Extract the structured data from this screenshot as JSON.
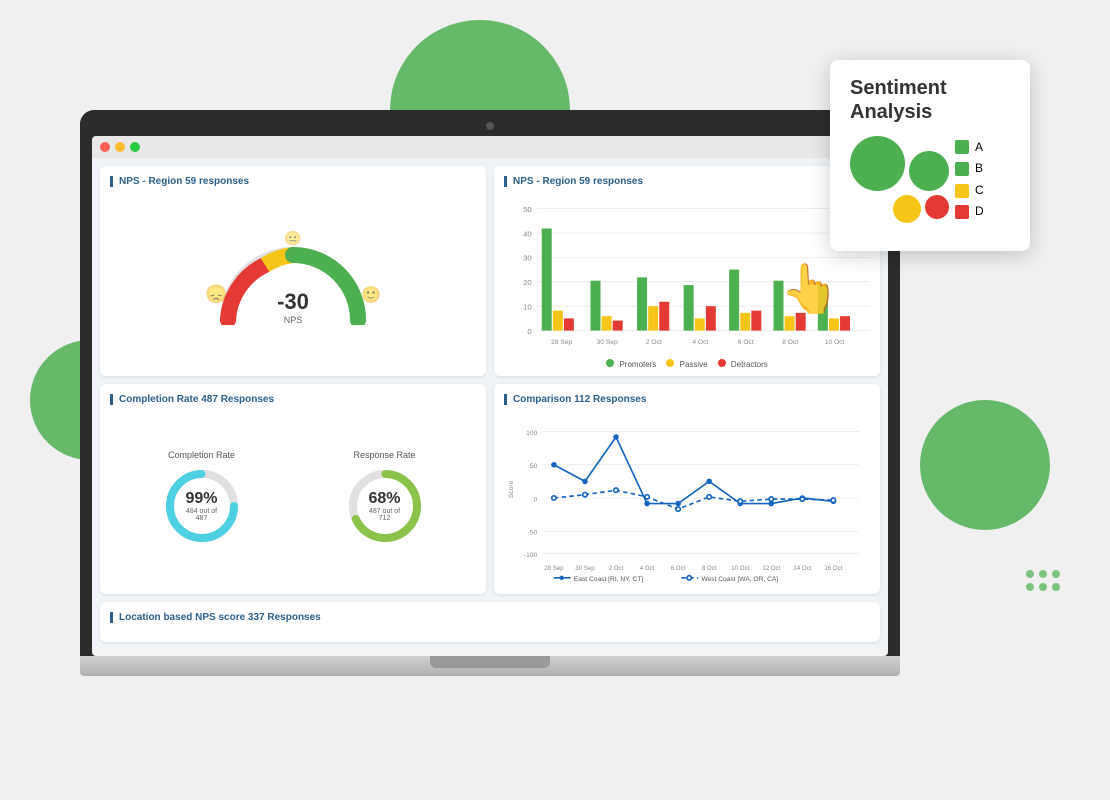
{
  "background": {
    "circles": [
      {
        "class": "bg-circle-top"
      },
      {
        "class": "bg-circle-left"
      },
      {
        "class": "bg-circle-right"
      }
    ]
  },
  "laptop": {
    "tl": [
      "red",
      "yellow",
      "green"
    ]
  },
  "panels": {
    "nps_gauge": {
      "title": "NPS - Region 59 responses",
      "value": "-30",
      "label": "NPS"
    },
    "nps_bar": {
      "title": "NPS - Region 59 responses",
      "legend": {
        "promoters": "Promoters",
        "passive": "Passive",
        "detractors": "Detractors"
      },
      "x_labels": [
        "28 Sep",
        "30 Sep",
        "2 Oct",
        "4 Oct",
        "6 Oct",
        "8 Oct",
        "10 Oct"
      ],
      "y_max": 50,
      "y_labels": [
        "50",
        "40",
        "30",
        "20",
        "10",
        "0"
      ],
      "bars": [
        {
          "promoters": 42,
          "passive": 8,
          "detractors": 5
        },
        {
          "promoters": 20,
          "passive": 6,
          "detractors": 4
        },
        {
          "promoters": 22,
          "passive": 10,
          "detractors": 12
        },
        {
          "promoters": 18,
          "passive": 5,
          "detractors": 10
        },
        {
          "promoters": 25,
          "passive": 7,
          "detractors": 8
        },
        {
          "promoters": 20,
          "passive": 6,
          "detractors": 7
        },
        {
          "promoters": 18,
          "passive": 5,
          "detractors": 6
        }
      ]
    },
    "completion": {
      "title": "Completion Rate 487 Responses",
      "completion_rate": {
        "label": "Completion Rate",
        "pct": "99%",
        "sub": "484 out of 487",
        "color": "#4dd0e1",
        "value": 99
      },
      "response_rate": {
        "label": "Response Rate",
        "pct": "68%",
        "sub": "487 out of 712",
        "color": "#8bc34a",
        "value": 68
      }
    },
    "comparison": {
      "title": "Comparison 112 Responses",
      "x_labels": [
        "28 Sep",
        "30 Sep",
        "2 Oct",
        "4 Oct",
        "6 Oct",
        "8 Oct",
        "10 Oct",
        "12 Oct",
        "14 Oct",
        "16 Oct"
      ],
      "y_labels": [
        "100",
        "50",
        "0",
        "-50",
        "-100"
      ],
      "y_axis_label": "Score",
      "series": {
        "east_coast": {
          "label": "East Coast [RI, NY, CT]",
          "color": "#1565c0"
        },
        "west_coast": {
          "label": "West Coast [WA, OR, CA]",
          "color": "#1565c0"
        }
      }
    },
    "location": {
      "title": "Location based NPS score 337 Responses"
    }
  },
  "sentiment_card": {
    "title": "Sentiment\nAnalysis",
    "legend": [
      {
        "letter": "A",
        "color": "green"
      },
      {
        "letter": "B",
        "color": "green"
      },
      {
        "letter": "C",
        "color": "yellow"
      },
      {
        "letter": "D",
        "color": "red"
      }
    ]
  },
  "colors": {
    "promoters": "#4caf50",
    "passive": "#f5c518",
    "detractors": "#e53935",
    "blue_accent": "#2c5f8a",
    "cyan": "#4dd0e1",
    "green_chart": "#8bc34a"
  }
}
